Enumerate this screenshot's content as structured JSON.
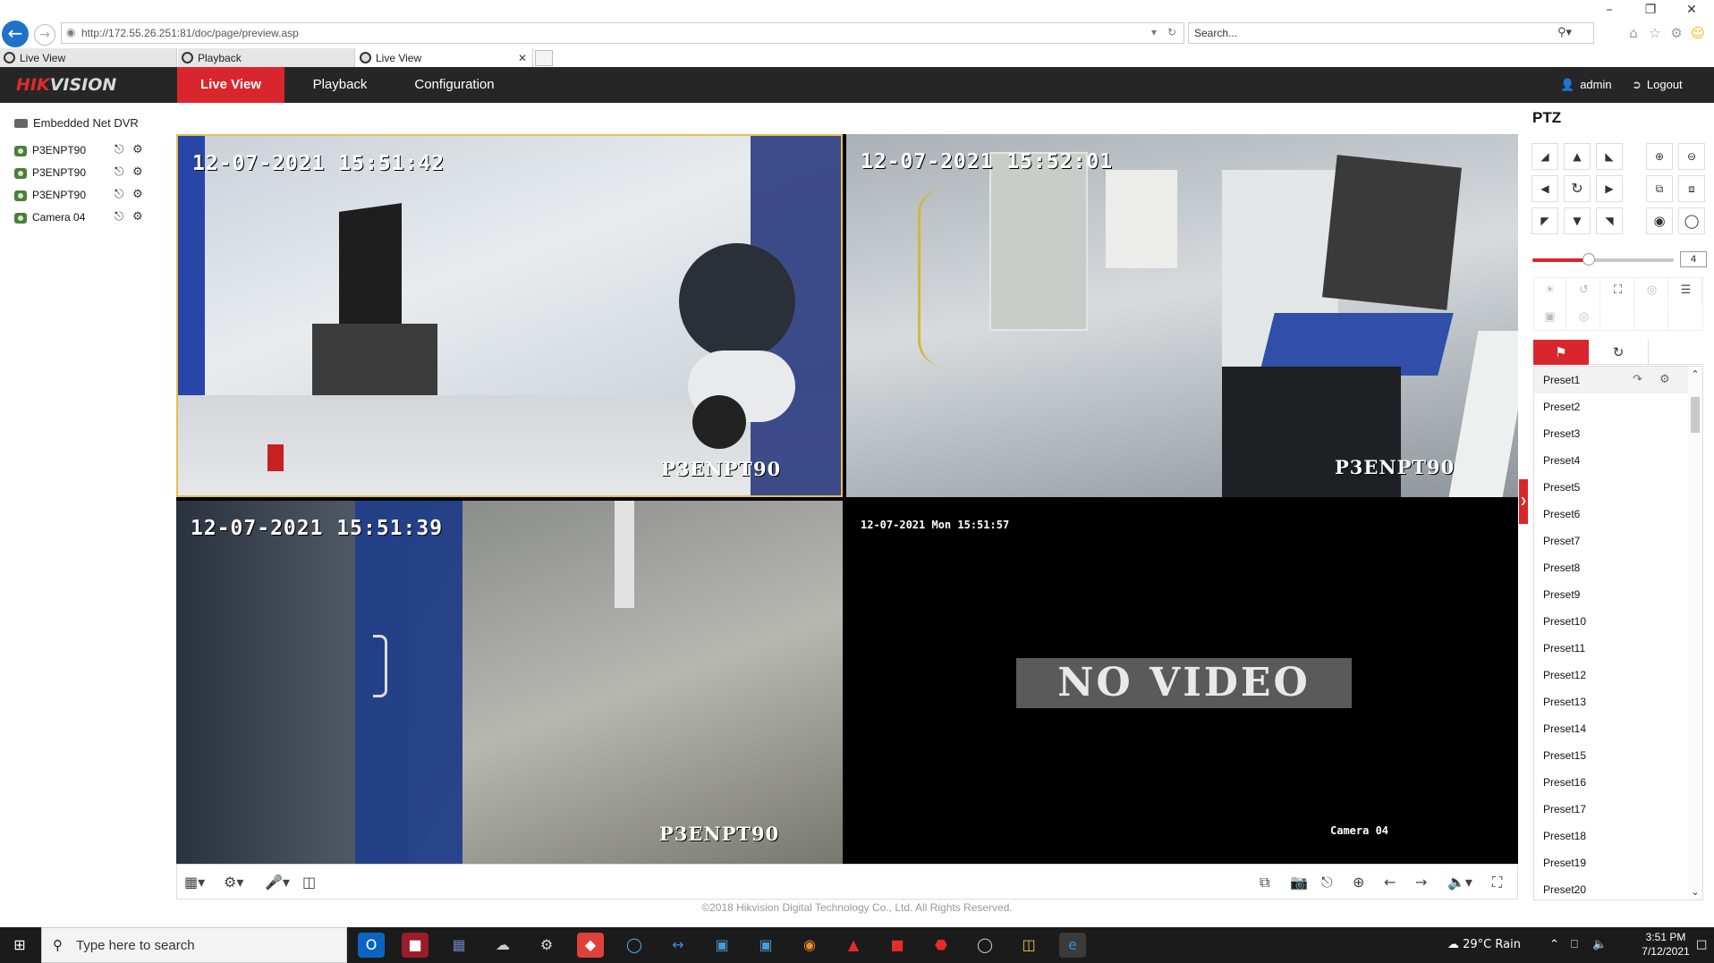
{
  "browser": {
    "url": "http://172.55.26.251:81/doc/page/preview.asp",
    "search_placeholder": "Search...",
    "tabs": [
      {
        "label": "Live View",
        "active": false
      },
      {
        "label": "Playback",
        "active": false
      },
      {
        "label": "Live View",
        "active": true
      }
    ],
    "window_buttons": {
      "minimize": "–",
      "restore": "❐",
      "close": "✕"
    }
  },
  "app": {
    "logo": {
      "part1": "HIK",
      "part2": "VISION"
    },
    "nav": [
      {
        "label": "Live View",
        "active": true
      },
      {
        "label": "Playback",
        "active": false
      },
      {
        "label": "Configuration",
        "active": false
      }
    ],
    "user": "admin",
    "logout": "Logout"
  },
  "sidebar": {
    "device": "Embedded Net DVR",
    "channels": [
      {
        "label": "P3ENPT90"
      },
      {
        "label": "P3ENPT90"
      },
      {
        "label": "P3ENPT90"
      },
      {
        "label": "Camera 04"
      }
    ]
  },
  "video": {
    "panes": [
      {
        "timestamp": "12-07-2021  15:51:42",
        "camera": "P3ENPT90"
      },
      {
        "timestamp": "12-07-2021  15:52:01",
        "camera": "P3ENPT90"
      },
      {
        "timestamp": "12-07-2021  15:51:39",
        "camera": "P3ENPT90"
      },
      {
        "timestamp": "12-07-2021 Mon 15:51:57",
        "camera": "Camera 04",
        "status": "NO VIDEO"
      }
    ]
  },
  "footer": {
    "copyright": "©2018 Hikvision Digital Technology Co., Ltd. All Rights Reserved."
  },
  "ptz": {
    "title": "PTZ",
    "speed": "4",
    "speed_fraction": 0.4,
    "presets": [
      "Preset1",
      "Preset2",
      "Preset3",
      "Preset4",
      "Preset5",
      "Preset6",
      "Preset7",
      "Preset8",
      "Preset9",
      "Preset10",
      "Preset11",
      "Preset12",
      "Preset13",
      "Preset14",
      "Preset15",
      "Preset16",
      "Preset17",
      "Preset18",
      "Preset19",
      "Preset20"
    ]
  },
  "taskbar": {
    "search_placeholder": "Type here to search",
    "weather": "29°C  Rain",
    "time": "3:51 PM",
    "date": "7/12/2021"
  },
  "colors": {
    "accent": "#d9262d",
    "header": "#262626",
    "selected_border": "#e7c050"
  }
}
